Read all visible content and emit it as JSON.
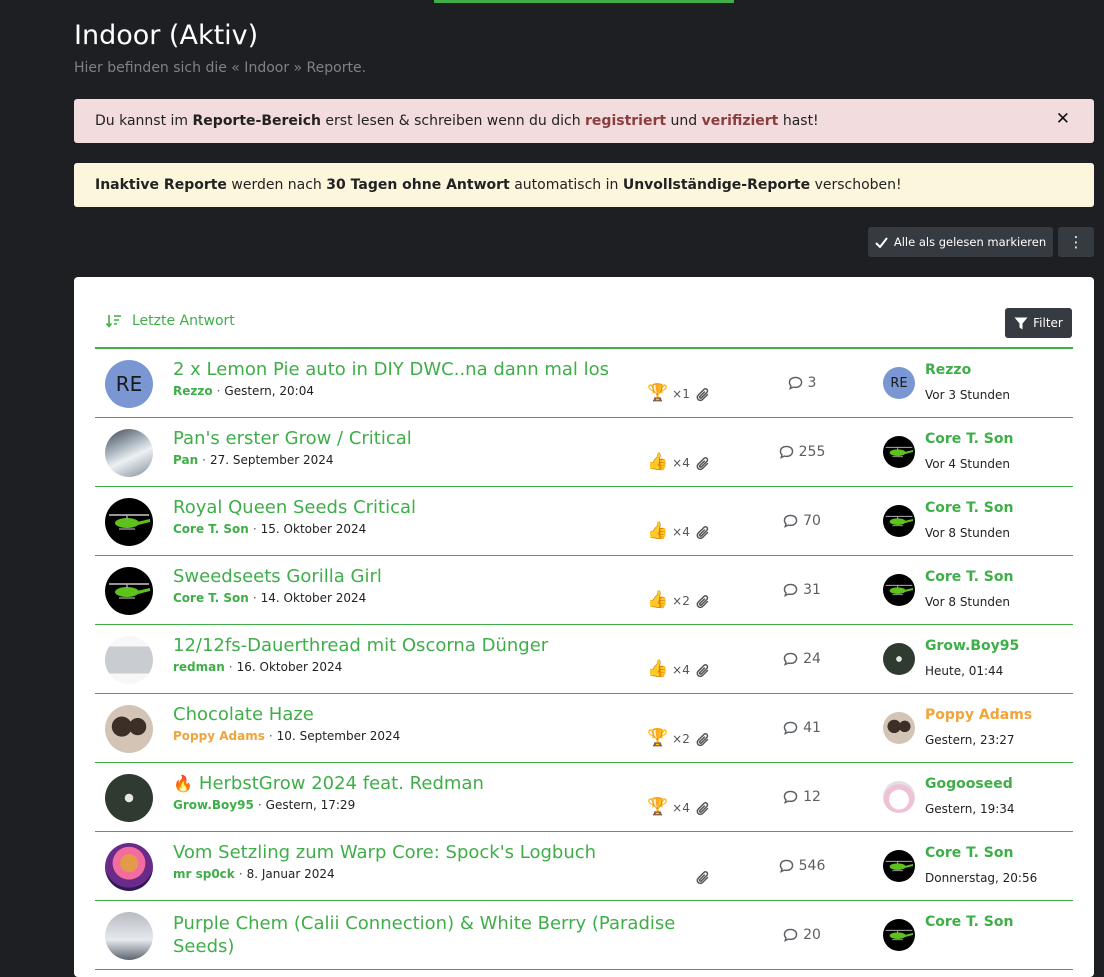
{
  "page": {
    "title": "Indoor (Aktiv)",
    "description": "Hier befinden sich die « Indoor » Reporte."
  },
  "notices": {
    "red": {
      "t1": "Du kannst im ",
      "b1": "Reporte-Bereich",
      "t2": " erst lesen & schreiben wenn du dich ",
      "l1": "registriert",
      "t3": " und ",
      "l2": "verifiziert",
      "t4": " hast!",
      "close": "✕"
    },
    "yellow": {
      "b1": "Inaktive Reporte",
      "t1": " werden nach ",
      "b2": "30 Tagen ohne Antwort",
      "t2": " automatisch in ",
      "b3": "Unvollständige-Reporte",
      "t3": " verschoben!"
    }
  },
  "toolbar": {
    "mark_read": "Alle als gelesen markieren",
    "more": "⋮"
  },
  "list": {
    "sort_label": "Letzte Antwort",
    "filter_label": "Filter"
  },
  "threads": [
    {
      "title": "2 x Lemon Pie auto in DIY DWC..na dann mal los",
      "author": "Rezzo",
      "date": "Gestern, 20:04",
      "avatar_text": "RE",
      "reaction_icon": "trophy-icon",
      "reaction_glyph": "🏆",
      "reaction_count": "×1",
      "attachment": true,
      "replies": "3",
      "last_user": "Rezzo",
      "last_avatar_text": "RE",
      "last_time": "Vor 3 Stunden"
    },
    {
      "title": "Pan's erster Grow / Critical",
      "author": "Pan",
      "date": "27. September 2024",
      "reaction_icon": "thumbs-up-icon",
      "reaction_glyph": "👍",
      "reaction_count": "×4",
      "attachment": true,
      "replies": "255",
      "last_user": "Core T. Son",
      "last_time": "Vor 4 Stunden"
    },
    {
      "title": "Royal Queen Seeds Critical",
      "author": "Core T. Son",
      "date": "15. Oktober 2024",
      "reaction_icon": "thumbs-up-icon",
      "reaction_glyph": "👍",
      "reaction_count": "×4",
      "attachment": true,
      "replies": "70",
      "last_user": "Core T. Son",
      "last_time": "Vor 8 Stunden"
    },
    {
      "title": "Sweedseets Gorilla Girl",
      "author": "Core T. Son",
      "date": "14. Oktober 2024",
      "reaction_icon": "thumbs-up-icon",
      "reaction_glyph": "👍",
      "reaction_count": "×2",
      "attachment": true,
      "replies": "31",
      "last_user": "Core T. Son",
      "last_time": "Vor 8 Stunden"
    },
    {
      "title": "12/12fs-Dauerthread mit Oscorna Dünger",
      "author": "redman",
      "date": "16. Oktober 2024",
      "reaction_icon": "thumbs-up-icon",
      "reaction_glyph": "👍",
      "reaction_count": "×4",
      "attachment": true,
      "replies": "24",
      "last_user": "Grow.Boy95",
      "last_time": "Heute, 01:44"
    },
    {
      "title": "Chocolate Haze",
      "author": "Poppy Adams",
      "date": "10. September 2024",
      "reaction_icon": "trophy-icon",
      "reaction_glyph": "🏆",
      "reaction_count": "×2",
      "attachment": true,
      "replies": "41",
      "last_user": "Poppy Adams",
      "last_time": "Gestern, 23:27"
    },
    {
      "title": "HerbstGrow 2024 feat. Redman",
      "prefix_glyph": "🔥",
      "author": "Grow.Boy95",
      "date": "Gestern, 17:29",
      "reaction_icon": "trophy-icon",
      "reaction_glyph": "🏆",
      "reaction_count": "×4",
      "attachment": true,
      "replies": "12",
      "last_user": "Gogooseed",
      "last_time": "Gestern, 19:34"
    },
    {
      "title": "Vom Setzling zum Warp Core: Spock's Logbuch",
      "author": "mr sp0ck",
      "date": "8. Januar 2024",
      "attachment": true,
      "replies": "546",
      "last_user": "Core T. Son",
      "last_time": "Donnerstag, 20:56"
    },
    {
      "title": "Purple Chem (Calii Connection) & White Berry (Paradise Seeds)",
      "replies": "20",
      "last_user": "Core T. Son"
    }
  ]
}
